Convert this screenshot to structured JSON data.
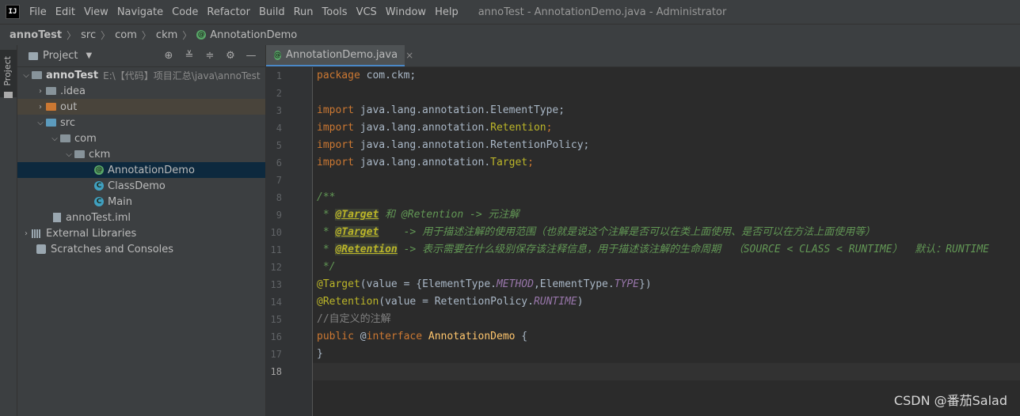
{
  "menubar": {
    "logo": "IJ",
    "items": [
      "File",
      "Edit",
      "View",
      "Navigate",
      "Code",
      "Refactor",
      "Build",
      "Run",
      "Tools",
      "VCS",
      "Window",
      "Help"
    ],
    "title": "annoTest - AnnotationDemo.java - Administrator"
  },
  "breadcrumb": {
    "items": [
      "annoTest",
      "src",
      "com",
      "ckm"
    ],
    "current": "AnnotationDemo",
    "icon": "annotation-icon"
  },
  "toolstrip": {
    "label": "Project"
  },
  "project_panel": {
    "title": "Project",
    "tools": [
      "target-icon",
      "collapse-all-icon",
      "expand-icon",
      "gear-icon",
      "minimize-icon"
    ],
    "tree": [
      {
        "label": "annoTest",
        "path": "E:\\【代码】项目汇总\\java\\annoTest",
        "level": 0,
        "expanded": true,
        "icon": "module-folder"
      },
      {
        "label": ".idea",
        "level": 1,
        "expanded": false,
        "icon": "folder"
      },
      {
        "label": "out",
        "level": 1,
        "expanded": false,
        "icon": "excluded-folder"
      },
      {
        "label": "src",
        "level": 1,
        "expanded": true,
        "icon": "source-folder"
      },
      {
        "label": "com",
        "level": 2,
        "expanded": true,
        "icon": "package"
      },
      {
        "label": "ckm",
        "level": 3,
        "expanded": true,
        "icon": "package"
      },
      {
        "label": "AnnotationDemo",
        "level": 4,
        "icon": "annotation",
        "selected": true
      },
      {
        "label": "ClassDemo",
        "level": 4,
        "icon": "class"
      },
      {
        "label": "Main",
        "level": 4,
        "icon": "class-main"
      },
      {
        "label": "annoTest.iml",
        "level": 1,
        "icon": "iml-file"
      },
      {
        "label": "External Libraries",
        "level": 0,
        "expanded": false,
        "icon": "library"
      },
      {
        "label": "Scratches and Consoles",
        "level": 0,
        "icon": "scratches"
      }
    ]
  },
  "editor": {
    "tab": {
      "label": "AnnotationDemo.java",
      "close": "×"
    },
    "current_line": 18,
    "line_numbers": [
      "1",
      "2",
      "3",
      "4",
      "5",
      "6",
      "7",
      "8",
      "9",
      "10",
      "11",
      "12",
      "13",
      "14",
      "15",
      "16",
      "17",
      "18"
    ],
    "lines": {
      "l1": {
        "kw": "package",
        "rest": " com.ckm;"
      },
      "l3": {
        "kw": "import",
        "rest": " java.lang.annotation.ElementType;"
      },
      "l4": {
        "kw": "import",
        "rest": " java.lang.annotation.",
        "ann": "Retention",
        "end": ";"
      },
      "l5": {
        "kw": "import",
        "rest": " java.lang.annotation.RetentionPolicy;"
      },
      "l6": {
        "kw": "import",
        "rest": " java.lang.annotation.",
        "ann": "Target",
        "end": ";"
      },
      "l8": "/**",
      "l9": {
        "pre": " * ",
        "tag": "@Target",
        "post": " 和 @Retention -> 元注解"
      },
      "l10": {
        "pre": " * ",
        "tag": "@Target",
        "post": "    -> 用于描述注解的使用范围（也就是说这个注解是否可以在类上面使用、是否可以在方法上面使用等）"
      },
      "l11": {
        "pre": " * ",
        "tag": "@Retention",
        "post": " -> 表示需要在什么级别保存该注释信息，用于描述该注解的生命周期  （SOURCE < CLASS < RUNTIME）  默认：RUNTIME"
      },
      "l12": " */",
      "l13": {
        "ann": "@Target",
        "a": "(value = {ElementType.",
        "c1": "METHOD",
        "b": ",ElementType.",
        "c2": "TYPE",
        "end": "})"
      },
      "l14": {
        "ann": "@Retention",
        "a": "(value = RetentionPolicy.",
        "c1": "RUNTIME",
        "end": ")"
      },
      "l15": "//自定义的注解",
      "l16": {
        "kw": "public",
        "mid": " @",
        "kw2": "interface",
        "sp": " ",
        "cls": "AnnotationDemo",
        "end": " {"
      },
      "l17": "}"
    }
  },
  "watermark": "CSDN @番茄Salad"
}
